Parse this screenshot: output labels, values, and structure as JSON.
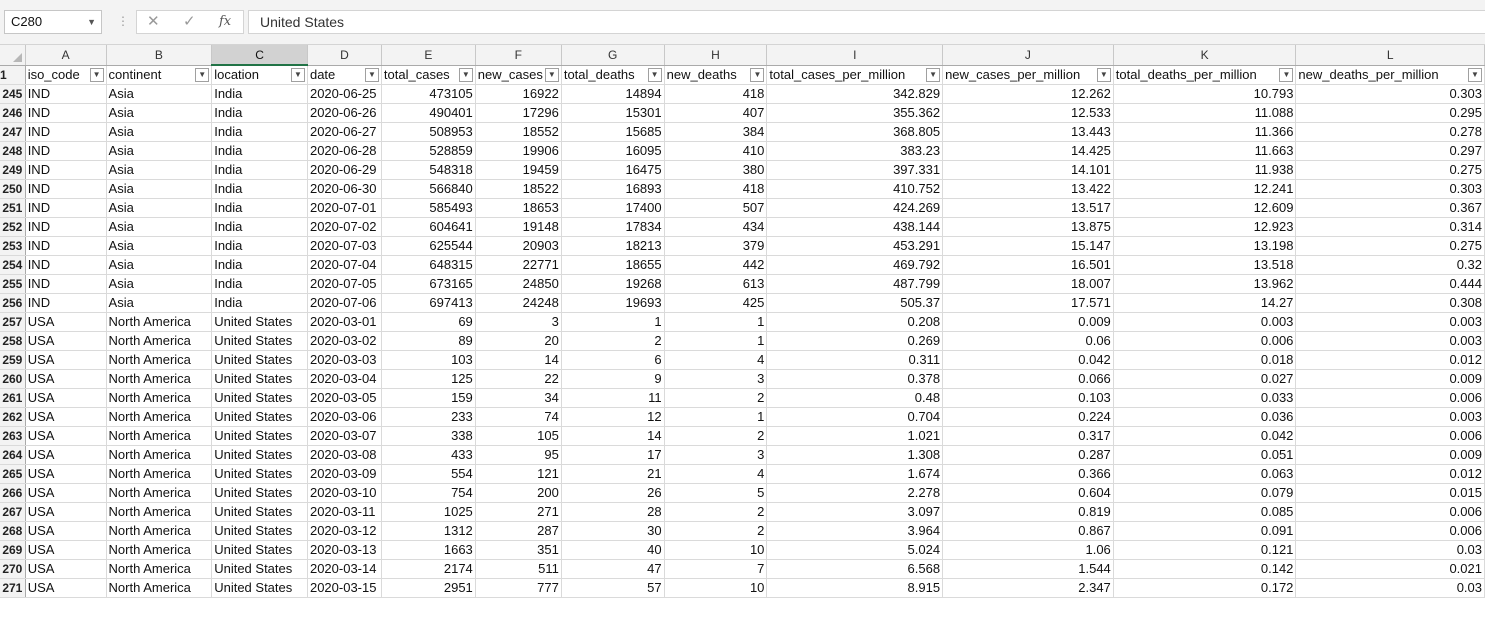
{
  "formula_bar": {
    "name_box": "C280",
    "cancel_icon": "✕",
    "enter_icon": "✓",
    "function_icon": "fx",
    "content": "United States"
  },
  "column_letters": [
    "A",
    "B",
    "C",
    "D",
    "E",
    "F",
    "G",
    "H",
    "I",
    "J",
    "K",
    "L"
  ],
  "selected_column": "C",
  "header_row_number": "1",
  "headers": [
    "iso_code",
    "continent",
    "location",
    "date",
    "total_cases",
    "new_cases",
    "total_deaths",
    "new_deaths",
    "total_cases_per_million",
    "new_cases_per_million",
    "total_deaths_per_million",
    "new_deaths_per_million"
  ],
  "rows": [
    {
      "n": "245",
      "c": [
        "IND",
        "Asia",
        "India",
        "2020-06-25",
        "473105",
        "16922",
        "14894",
        "418",
        "342.829",
        "12.262",
        "10.793",
        "0.303"
      ]
    },
    {
      "n": "246",
      "c": [
        "IND",
        "Asia",
        "India",
        "2020-06-26",
        "490401",
        "17296",
        "15301",
        "407",
        "355.362",
        "12.533",
        "11.088",
        "0.295"
      ]
    },
    {
      "n": "247",
      "c": [
        "IND",
        "Asia",
        "India",
        "2020-06-27",
        "508953",
        "18552",
        "15685",
        "384",
        "368.805",
        "13.443",
        "11.366",
        "0.278"
      ]
    },
    {
      "n": "248",
      "c": [
        "IND",
        "Asia",
        "India",
        "2020-06-28",
        "528859",
        "19906",
        "16095",
        "410",
        "383.23",
        "14.425",
        "11.663",
        "0.297"
      ]
    },
    {
      "n": "249",
      "c": [
        "IND",
        "Asia",
        "India",
        "2020-06-29",
        "548318",
        "19459",
        "16475",
        "380",
        "397.331",
        "14.101",
        "11.938",
        "0.275"
      ]
    },
    {
      "n": "250",
      "c": [
        "IND",
        "Asia",
        "India",
        "2020-06-30",
        "566840",
        "18522",
        "16893",
        "418",
        "410.752",
        "13.422",
        "12.241",
        "0.303"
      ]
    },
    {
      "n": "251",
      "c": [
        "IND",
        "Asia",
        "India",
        "2020-07-01",
        "585493",
        "18653",
        "17400",
        "507",
        "424.269",
        "13.517",
        "12.609",
        "0.367"
      ]
    },
    {
      "n": "252",
      "c": [
        "IND",
        "Asia",
        "India",
        "2020-07-02",
        "604641",
        "19148",
        "17834",
        "434",
        "438.144",
        "13.875",
        "12.923",
        "0.314"
      ]
    },
    {
      "n": "253",
      "c": [
        "IND",
        "Asia",
        "India",
        "2020-07-03",
        "625544",
        "20903",
        "18213",
        "379",
        "453.291",
        "15.147",
        "13.198",
        "0.275"
      ]
    },
    {
      "n": "254",
      "c": [
        "IND",
        "Asia",
        "India",
        "2020-07-04",
        "648315",
        "22771",
        "18655",
        "442",
        "469.792",
        "16.501",
        "13.518",
        "0.32"
      ]
    },
    {
      "n": "255",
      "c": [
        "IND",
        "Asia",
        "India",
        "2020-07-05",
        "673165",
        "24850",
        "19268",
        "613",
        "487.799",
        "18.007",
        "13.962",
        "0.444"
      ]
    },
    {
      "n": "256",
      "c": [
        "IND",
        "Asia",
        "India",
        "2020-07-06",
        "697413",
        "24248",
        "19693",
        "425",
        "505.37",
        "17.571",
        "14.27",
        "0.308"
      ]
    },
    {
      "n": "257",
      "c": [
        "USA",
        "North America",
        "United States",
        "2020-03-01",
        "69",
        "3",
        "1",
        "1",
        "0.208",
        "0.009",
        "0.003",
        "0.003"
      ]
    },
    {
      "n": "258",
      "c": [
        "USA",
        "North America",
        "United States",
        "2020-03-02",
        "89",
        "20",
        "2",
        "1",
        "0.269",
        "0.06",
        "0.006",
        "0.003"
      ]
    },
    {
      "n": "259",
      "c": [
        "USA",
        "North America",
        "United States",
        "2020-03-03",
        "103",
        "14",
        "6",
        "4",
        "0.311",
        "0.042",
        "0.018",
        "0.012"
      ]
    },
    {
      "n": "260",
      "c": [
        "USA",
        "North America",
        "United States",
        "2020-03-04",
        "125",
        "22",
        "9",
        "3",
        "0.378",
        "0.066",
        "0.027",
        "0.009"
      ]
    },
    {
      "n": "261",
      "c": [
        "USA",
        "North America",
        "United States",
        "2020-03-05",
        "159",
        "34",
        "11",
        "2",
        "0.48",
        "0.103",
        "0.033",
        "0.006"
      ]
    },
    {
      "n": "262",
      "c": [
        "USA",
        "North America",
        "United States",
        "2020-03-06",
        "233",
        "74",
        "12",
        "1",
        "0.704",
        "0.224",
        "0.036",
        "0.003"
      ]
    },
    {
      "n": "263",
      "c": [
        "USA",
        "North America",
        "United States",
        "2020-03-07",
        "338",
        "105",
        "14",
        "2",
        "1.021",
        "0.317",
        "0.042",
        "0.006"
      ]
    },
    {
      "n": "264",
      "c": [
        "USA",
        "North America",
        "United States",
        "2020-03-08",
        "433",
        "95",
        "17",
        "3",
        "1.308",
        "0.287",
        "0.051",
        "0.009"
      ]
    },
    {
      "n": "265",
      "c": [
        "USA",
        "North America",
        "United States",
        "2020-03-09",
        "554",
        "121",
        "21",
        "4",
        "1.674",
        "0.366",
        "0.063",
        "0.012"
      ]
    },
    {
      "n": "266",
      "c": [
        "USA",
        "North America",
        "United States",
        "2020-03-10",
        "754",
        "200",
        "26",
        "5",
        "2.278",
        "0.604",
        "0.079",
        "0.015"
      ]
    },
    {
      "n": "267",
      "c": [
        "USA",
        "North America",
        "United States",
        "2020-03-11",
        "1025",
        "271",
        "28",
        "2",
        "3.097",
        "0.819",
        "0.085",
        "0.006"
      ]
    },
    {
      "n": "268",
      "c": [
        "USA",
        "North America",
        "United States",
        "2020-03-12",
        "1312",
        "287",
        "30",
        "2",
        "3.964",
        "0.867",
        "0.091",
        "0.006"
      ]
    },
    {
      "n": "269",
      "c": [
        "USA",
        "North America",
        "United States",
        "2020-03-13",
        "1663",
        "351",
        "40",
        "10",
        "5.024",
        "1.06",
        "0.121",
        "0.03"
      ]
    },
    {
      "n": "270",
      "c": [
        "USA",
        "North America",
        "United States",
        "2020-03-14",
        "2174",
        "511",
        "47",
        "7",
        "6.568",
        "1.544",
        "0.142",
        "0.021"
      ]
    },
    {
      "n": "271",
      "c": [
        "USA",
        "North America",
        "United States",
        "2020-03-15",
        "2951",
        "777",
        "57",
        "10",
        "8.915",
        "2.347",
        "0.172",
        "0.03"
      ]
    }
  ]
}
